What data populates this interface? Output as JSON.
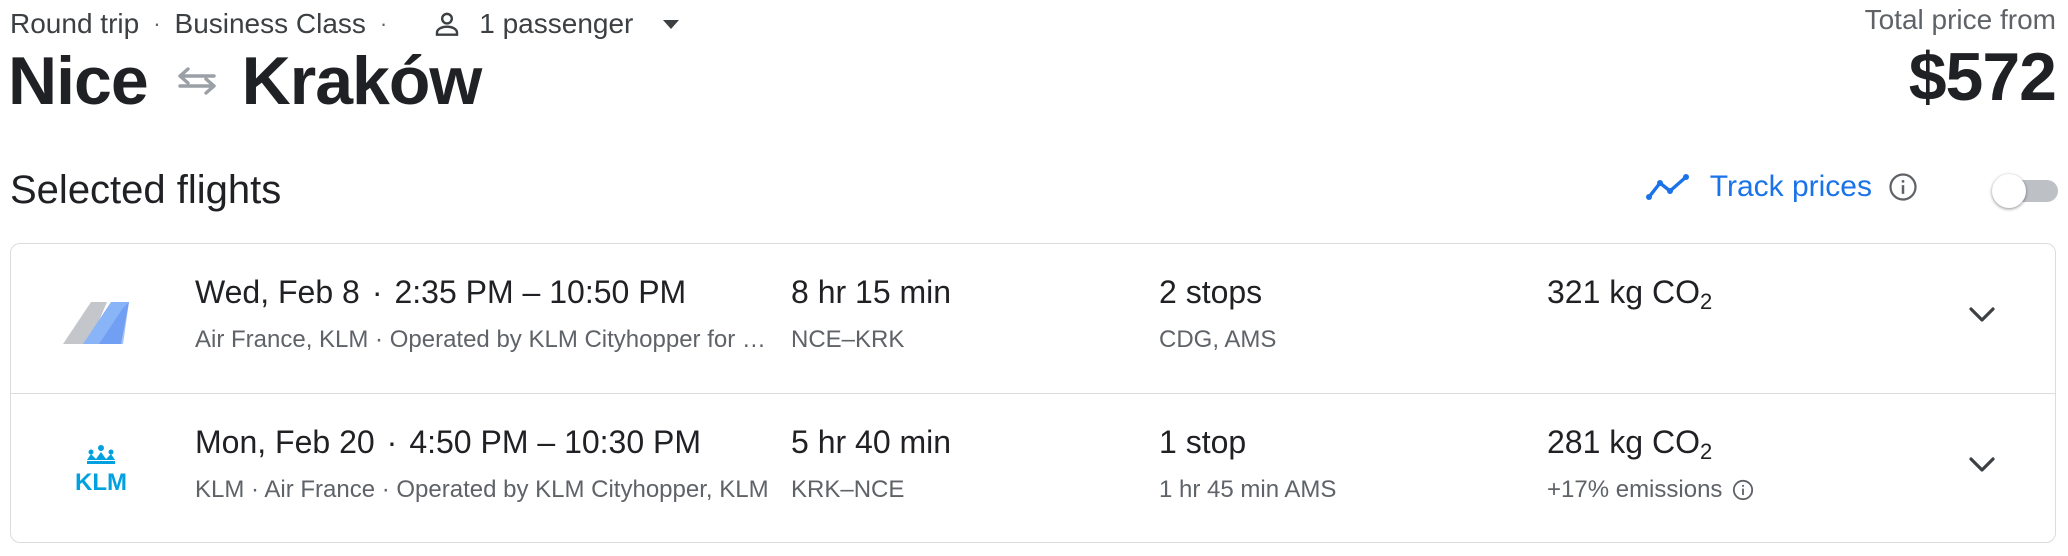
{
  "header": {
    "trip_type": "Round trip",
    "cabin_class": "Business Class",
    "passengers": "1 passenger",
    "origin": "Nice",
    "destination": "Kraków",
    "price_label": "Total price from",
    "price_value": "$572"
  },
  "section": {
    "title": "Selected flights",
    "track_label": "Track prices",
    "track_enabled": false
  },
  "flights": [
    {
      "date": "Wed, Feb 8",
      "times": "2:35 PM – 10:50 PM",
      "airlines": "Air France, KLM · Operated by KLM Cityhopper for KLM",
      "duration": "8 hr 15 min",
      "route": "NCE–KRK",
      "stops": "2 stops",
      "stop_detail": "CDG, AMS",
      "co2_value": "321 kg CO",
      "co2_sub": "2",
      "emissions_note": "",
      "logo": "air-france-klm-logo"
    },
    {
      "date": "Mon, Feb 20",
      "times": "4:50 PM – 10:30 PM",
      "airlines": "KLM · Air France · Operated by KLM Cityhopper, KLM",
      "duration": "5 hr 40 min",
      "route": "KRK–NCE",
      "stops": "1 stop",
      "stop_detail": "1 hr 45 min AMS",
      "co2_value": "281 kg CO",
      "co2_sub": "2",
      "emissions_note": "+17% emissions",
      "logo": "klm-logo",
      "logo_text": "KLM"
    }
  ],
  "colors": {
    "accent": "#1a73e8",
    "text_primary": "#202124",
    "text_secondary": "#5f6368",
    "divider": "#dadce0",
    "klm_blue": "#00a1de"
  }
}
